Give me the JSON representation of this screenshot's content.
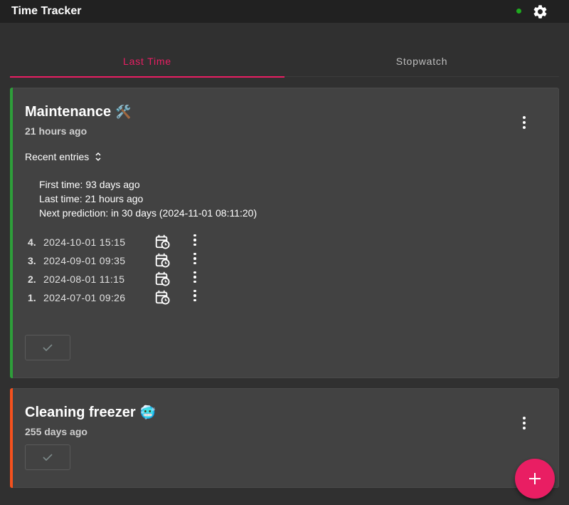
{
  "app": {
    "title": "Time Tracker",
    "status_color": "#1faa1f"
  },
  "tabs": [
    {
      "label": "Last Time",
      "active": true
    },
    {
      "label": "Stopwatch",
      "active": false
    }
  ],
  "cards": [
    {
      "title": "Maintenance",
      "emoji": "🛠️",
      "subtitle": "21 hours ago",
      "accent": "#2e9e3a",
      "recent_label": "Recent entries",
      "stats": {
        "first": "First time: 93 days ago",
        "last": "Last time: 21 hours ago",
        "next": "Next prediction: in 30 days (2024-11-01 08:11:20)"
      },
      "entries": [
        {
          "num": "4.",
          "date": "2024-10-01 15:15"
        },
        {
          "num": "3.",
          "date": "2024-09-01 09:35"
        },
        {
          "num": "2.",
          "date": "2024-08-01 11:15"
        },
        {
          "num": "1.",
          "date": "2024-07-01 09:26"
        }
      ]
    },
    {
      "title": "Cleaning freezer",
      "emoji": "🥶",
      "subtitle": "255 days ago",
      "accent": "#f4511e"
    }
  ],
  "icons": {
    "settings": "gear-icon",
    "more": "more-vert-icon",
    "calendar": "calendar-clock-icon",
    "check": "check-icon",
    "add": "add-icon",
    "expand": "unfold-icon"
  }
}
